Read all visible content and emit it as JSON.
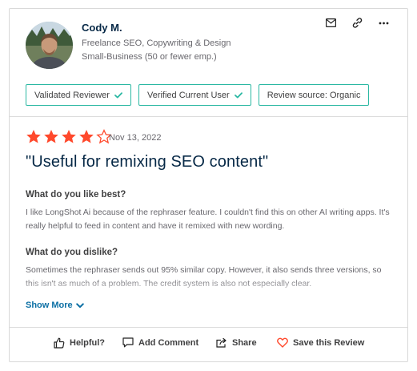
{
  "reviewer": {
    "name": "Cody M.",
    "role": "Freelance SEO, Copywriting & Design",
    "company_size": "Small-Business (50 or fewer emp.)"
  },
  "header_icons": [
    "mail-icon",
    "link-icon",
    "more-icon"
  ],
  "badges": [
    {
      "label": "Validated Reviewer",
      "check": true
    },
    {
      "label": "Verified Current User",
      "check": true
    },
    {
      "label": "Review source: Organic",
      "check": false
    }
  ],
  "review": {
    "rating": 4,
    "rating_max": 5,
    "date": "Nov 13, 2022",
    "title": "\"Useful for remixing SEO content\"",
    "q1": "What do you like best?",
    "a1": "I like LongShot Ai because of the rephraser feature. I couldn't find this on other AI writing apps. It's really helpful to feed in content and have it remixed with new wording.",
    "q2": "What do you dislike?",
    "a2": "Sometimes the rephraser sends out 95% similar copy. However, it also sends three versions, so this isn't as much of a problem. The credit system is also not especially clear.",
    "show_more": "Show More"
  },
  "actions": {
    "helpful": "Helpful?",
    "comment": "Add Comment",
    "share": "Share",
    "save": "Save this Review"
  },
  "colors": {
    "star": "#ff492c",
    "badge_border": "#2bb8a3",
    "check": "#2bb8a3",
    "link": "#0b6fa4",
    "heart": "#ff492c"
  }
}
